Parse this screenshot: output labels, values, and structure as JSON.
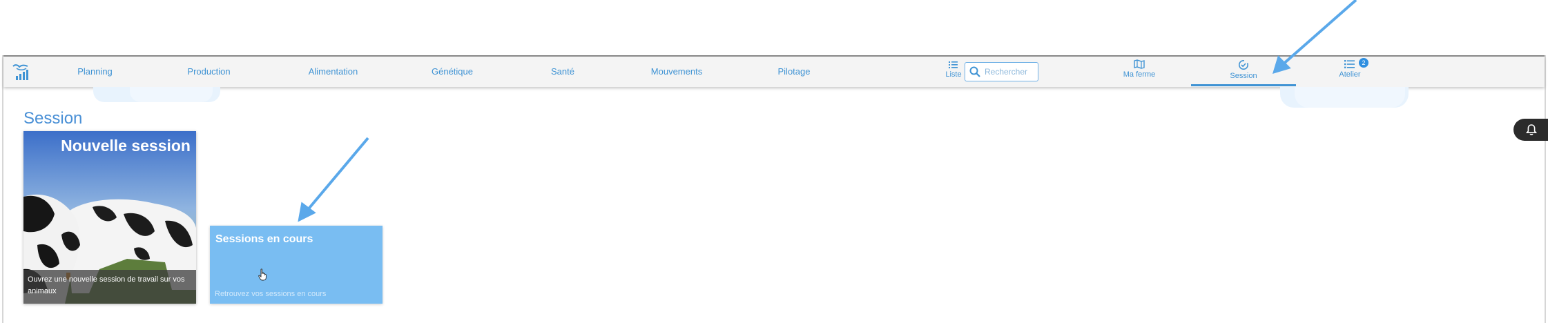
{
  "colors": {
    "accent": "#3f93d4",
    "card_blue": "#79bdf2",
    "annotation_arrow": "#5aa8ea",
    "bell_bg": "#2b2b2b"
  },
  "navbar": {
    "logo_icon": "cow-chart-icon",
    "menu": [
      {
        "label": "Planning"
      },
      {
        "label": "Production"
      },
      {
        "label": "Alimentation"
      },
      {
        "label": "Génétique"
      },
      {
        "label": "Santé"
      },
      {
        "label": "Mouvements"
      },
      {
        "label": "Pilotage"
      }
    ],
    "liste_label": "Liste",
    "search_placeholder": "Rechercher",
    "tabs": [
      {
        "label": "Ma ferme",
        "icon": "map-icon"
      },
      {
        "label": "Session",
        "icon": "check-circle-icon",
        "active": true
      },
      {
        "label": "Atelier",
        "icon": "list-icon",
        "badge": "2"
      }
    ]
  },
  "main": {
    "title": "Session",
    "cards": [
      {
        "title": "Nouvelle session",
        "caption": "Ouvrez une nouvelle session de travail sur vos animaux"
      },
      {
        "title": "Sessions en cours",
        "caption": "Retrouvez vos sessions en cours"
      }
    ]
  },
  "notification_icon": "bell-icon"
}
